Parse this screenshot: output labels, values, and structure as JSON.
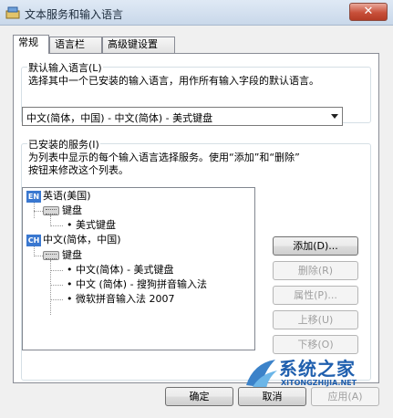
{
  "window": {
    "title": "文本服务和输入语言",
    "close_glyph": "✕"
  },
  "tabs": [
    {
      "label": "常规",
      "active": true
    },
    {
      "label": "语言栏",
      "active": false
    },
    {
      "label": "高级键设置",
      "active": false
    }
  ],
  "default_language": {
    "group_label": "默认输入语言(L)",
    "description": "选择其中一个已安装的输入语言，用作所有输入字段的默认语言。",
    "selected": "中文(简体，中国) - 中文(简体) - 美式键盘"
  },
  "installed_services": {
    "group_label": "已安装的服务(I)",
    "description_line1": "为列表中显示的每个输入语言选择服务。使用“添加”和“删除”",
    "description_line2": "按钮来修改这个列表。",
    "tree": {
      "en_badge": "EN",
      "en_name": "英语(美国)",
      "en_keyboard_header": "键盘",
      "en_keyboard_item": "美式键盘",
      "ch_badge": "CH",
      "ch_name": "中文(简体，中国)",
      "ch_keyboard_header": "键盘",
      "ch_items": [
        "中文(简体) - 美式键盘",
        "中文 (简体) - 搜狗拼音输入法",
        "微软拼音输入法 2007"
      ]
    },
    "buttons": {
      "add": "添加(D)...",
      "remove": "删除(R)",
      "properties": "属性(P)...",
      "move_up": "上移(U)",
      "move_down": "下移(O)"
    }
  },
  "footer": {
    "ok": "确定",
    "cancel": "取消",
    "apply": "应用(A)"
  },
  "watermark": {
    "main": "系统之家",
    "sub": "XITONGZHIJIA.NET"
  },
  "colors": {
    "accent": "#3a78d0",
    "title_bg": "#dfe9f5",
    "close": "#c8503a",
    "watermark": "#1f5fae"
  },
  "icons": [
    "app-icon",
    "close-icon",
    "dropdown-arrow-icon",
    "language-badge-icon",
    "keyboard-icon"
  ]
}
